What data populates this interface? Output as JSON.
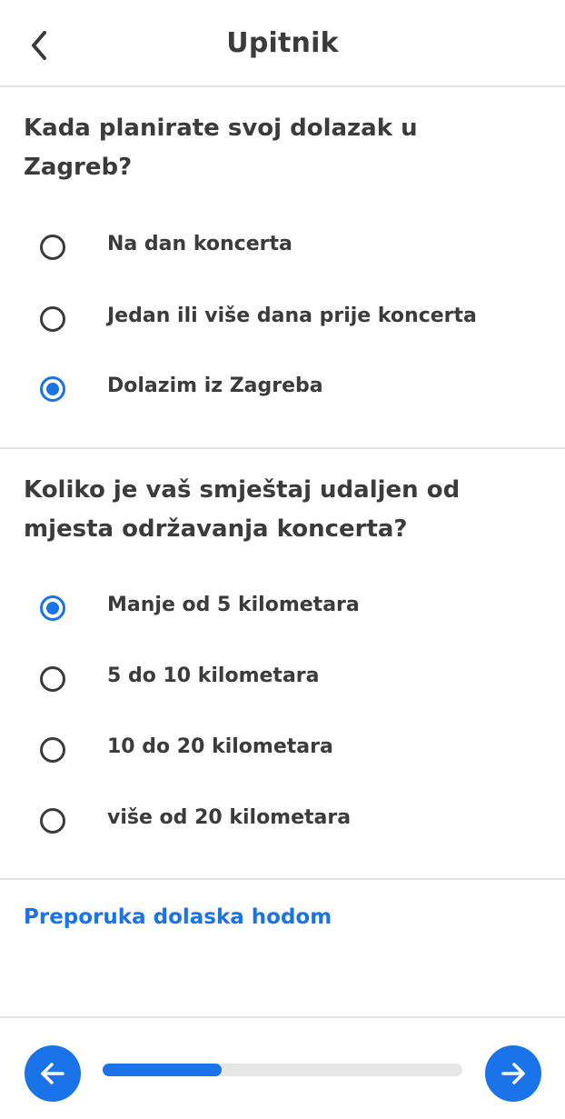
{
  "header": {
    "title": "Upitnik",
    "back_icon": "chevron-left-icon"
  },
  "questions": [
    {
      "text": "Kada planirate svoj dolazak u Zagreb?",
      "options": [
        {
          "label": "Na dan koncerta",
          "selected": false
        },
        {
          "label": "Jedan ili više dana prije koncerta",
          "selected": false
        },
        {
          "label": "Dolazim iz Zagreba",
          "selected": true
        }
      ]
    },
    {
      "text": "Koliko je vaš smještaj udaljen od mjesta održavanja koncerta?",
      "options": [
        {
          "label": "Manje od 5 kilometara",
          "selected": true
        },
        {
          "label": "5 do 10 kilometara",
          "selected": false
        },
        {
          "label": "10 do 20 kilometara",
          "selected": false
        },
        {
          "label": "više od 20 kilometara",
          "selected": false
        }
      ]
    }
  ],
  "recommendation": {
    "text": "Preporuka dolaska hodom"
  },
  "footer": {
    "prev_icon": "arrow-left-icon",
    "next_icon": "arrow-right-icon",
    "progress_fraction": 0.33
  },
  "colors": {
    "accent": "#1a73e8",
    "text": "#3b3b3b",
    "divider": "#e3e3e3",
    "track": "#e6e6e6"
  }
}
